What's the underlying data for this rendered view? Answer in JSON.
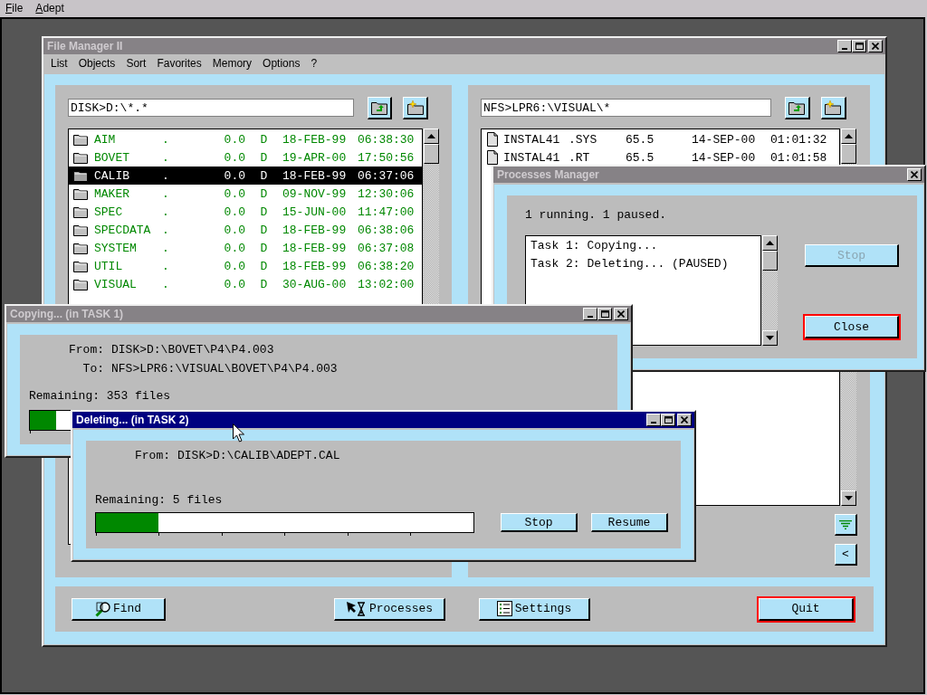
{
  "menu_bar": [
    "File",
    "Adept"
  ],
  "file_manager": {
    "title": "File Manager II",
    "active": false,
    "minimizable": true,
    "menu": [
      "List",
      "Objects",
      "Sort",
      "Favorites",
      "Memory",
      "Options",
      "?"
    ],
    "left_panel": {
      "path": "DISK>D:\\*.*",
      "files": [
        {
          "kind": "folder",
          "name": "AIM",
          "ext": ".",
          "size": "0.0",
          "attr": "D",
          "date": "18-FEB-99",
          "time": "06:38:30",
          "selected": false
        },
        {
          "kind": "folder",
          "name": "BOVET",
          "ext": ".",
          "size": "0.0",
          "attr": "D",
          "date": "19-APR-00",
          "time": "17:50:56",
          "selected": false
        },
        {
          "kind": "folder",
          "name": "CALIB",
          "ext": ".",
          "size": "0.0",
          "attr": "D",
          "date": "18-FEB-99",
          "time": "06:37:06",
          "selected": true
        },
        {
          "kind": "folder",
          "name": "MAKER",
          "ext": ".",
          "size": "0.0",
          "attr": "D",
          "date": "09-NOV-99",
          "time": "12:30:06",
          "selected": false
        },
        {
          "kind": "folder",
          "name": "SPEC",
          "ext": ".",
          "size": "0.0",
          "attr": "D",
          "date": "15-JUN-00",
          "time": "11:47:00",
          "selected": false
        },
        {
          "kind": "folder",
          "name": "SPECDATA",
          "ext": ".",
          "size": "0.0",
          "attr": "D",
          "date": "18-FEB-99",
          "time": "06:38:06",
          "selected": false
        },
        {
          "kind": "folder",
          "name": "SYSTEM",
          "ext": ".",
          "size": "0.0",
          "attr": "D",
          "date": "18-FEB-99",
          "time": "06:37:08",
          "selected": false
        },
        {
          "kind": "folder",
          "name": "UTIL",
          "ext": ".",
          "size": "0.0",
          "attr": "D",
          "date": "18-FEB-99",
          "time": "06:38:20",
          "selected": false
        },
        {
          "kind": "folder",
          "name": "VISUAL",
          "ext": ".",
          "size": "0.0",
          "attr": "D",
          "date": "30-AUG-00",
          "time": "13:02:00",
          "selected": false
        }
      ]
    },
    "right_panel": {
      "path": "NFS>LPR6:\\VISUAL\\*",
      "files": [
        {
          "kind": "file",
          "name": "INSTAL41",
          "ext": ".SYS",
          "size": "65.5",
          "date": "14-SEP-00",
          "time": "01:01:32",
          "selected": false
        },
        {
          "kind": "file",
          "name": "INSTAL41",
          "ext": ".RT",
          "size": "65.5",
          "date": "14-SEP-00",
          "time": "01:01:58",
          "selected": false
        }
      ],
      "side_buttons": [
        {
          "kind": "filter"
        },
        {
          "kind": "label",
          "label": "<"
        }
      ]
    },
    "buttons": [
      {
        "kind": "find",
        "label": "Find",
        "default": false
      },
      {
        "kind": "processes",
        "label": "Processes",
        "default": false
      },
      {
        "kind": "settings",
        "label": "Settings",
        "default": false
      },
      {
        "kind": "plain",
        "label": "Quit",
        "default": true
      }
    ]
  },
  "processes_manager": {
    "title": "Processes Manager",
    "active": false,
    "minimizable": false,
    "status": "1 running. 1 paused.",
    "tasks": [
      "Task 1: Copying...",
      "Task 2: Deleting... (PAUSED)"
    ],
    "buttons": [
      {
        "label": "Stop",
        "disabled": true,
        "default": false
      },
      {
        "label": "Close",
        "disabled": false,
        "default": true
      }
    ]
  },
  "copy_window": {
    "title": "Copying... (in TASK 1)",
    "active": false,
    "minimizable": true,
    "lines": [
      {
        "label": "From:",
        "value": "DISK>D:\\BOVET\\P4\\P4.003"
      },
      {
        "label": "To:",
        "value": "NFS>LPR6:\\VISUAL\\BOVET\\P4\\P4.003"
      }
    ],
    "remaining": "Remaining: 353 files",
    "level": 0.07
  },
  "delete_window": {
    "title": "Deleting... (in TASK 2)",
    "active": true,
    "minimizable": true,
    "lines": [
      {
        "label": "From:",
        "value": "DISK>D:\\CALIB\\ADEPT.CAL"
      }
    ],
    "remaining": "Remaining: 5 files",
    "level": 0.165,
    "buttons": [
      "Stop",
      "Resume"
    ]
  }
}
